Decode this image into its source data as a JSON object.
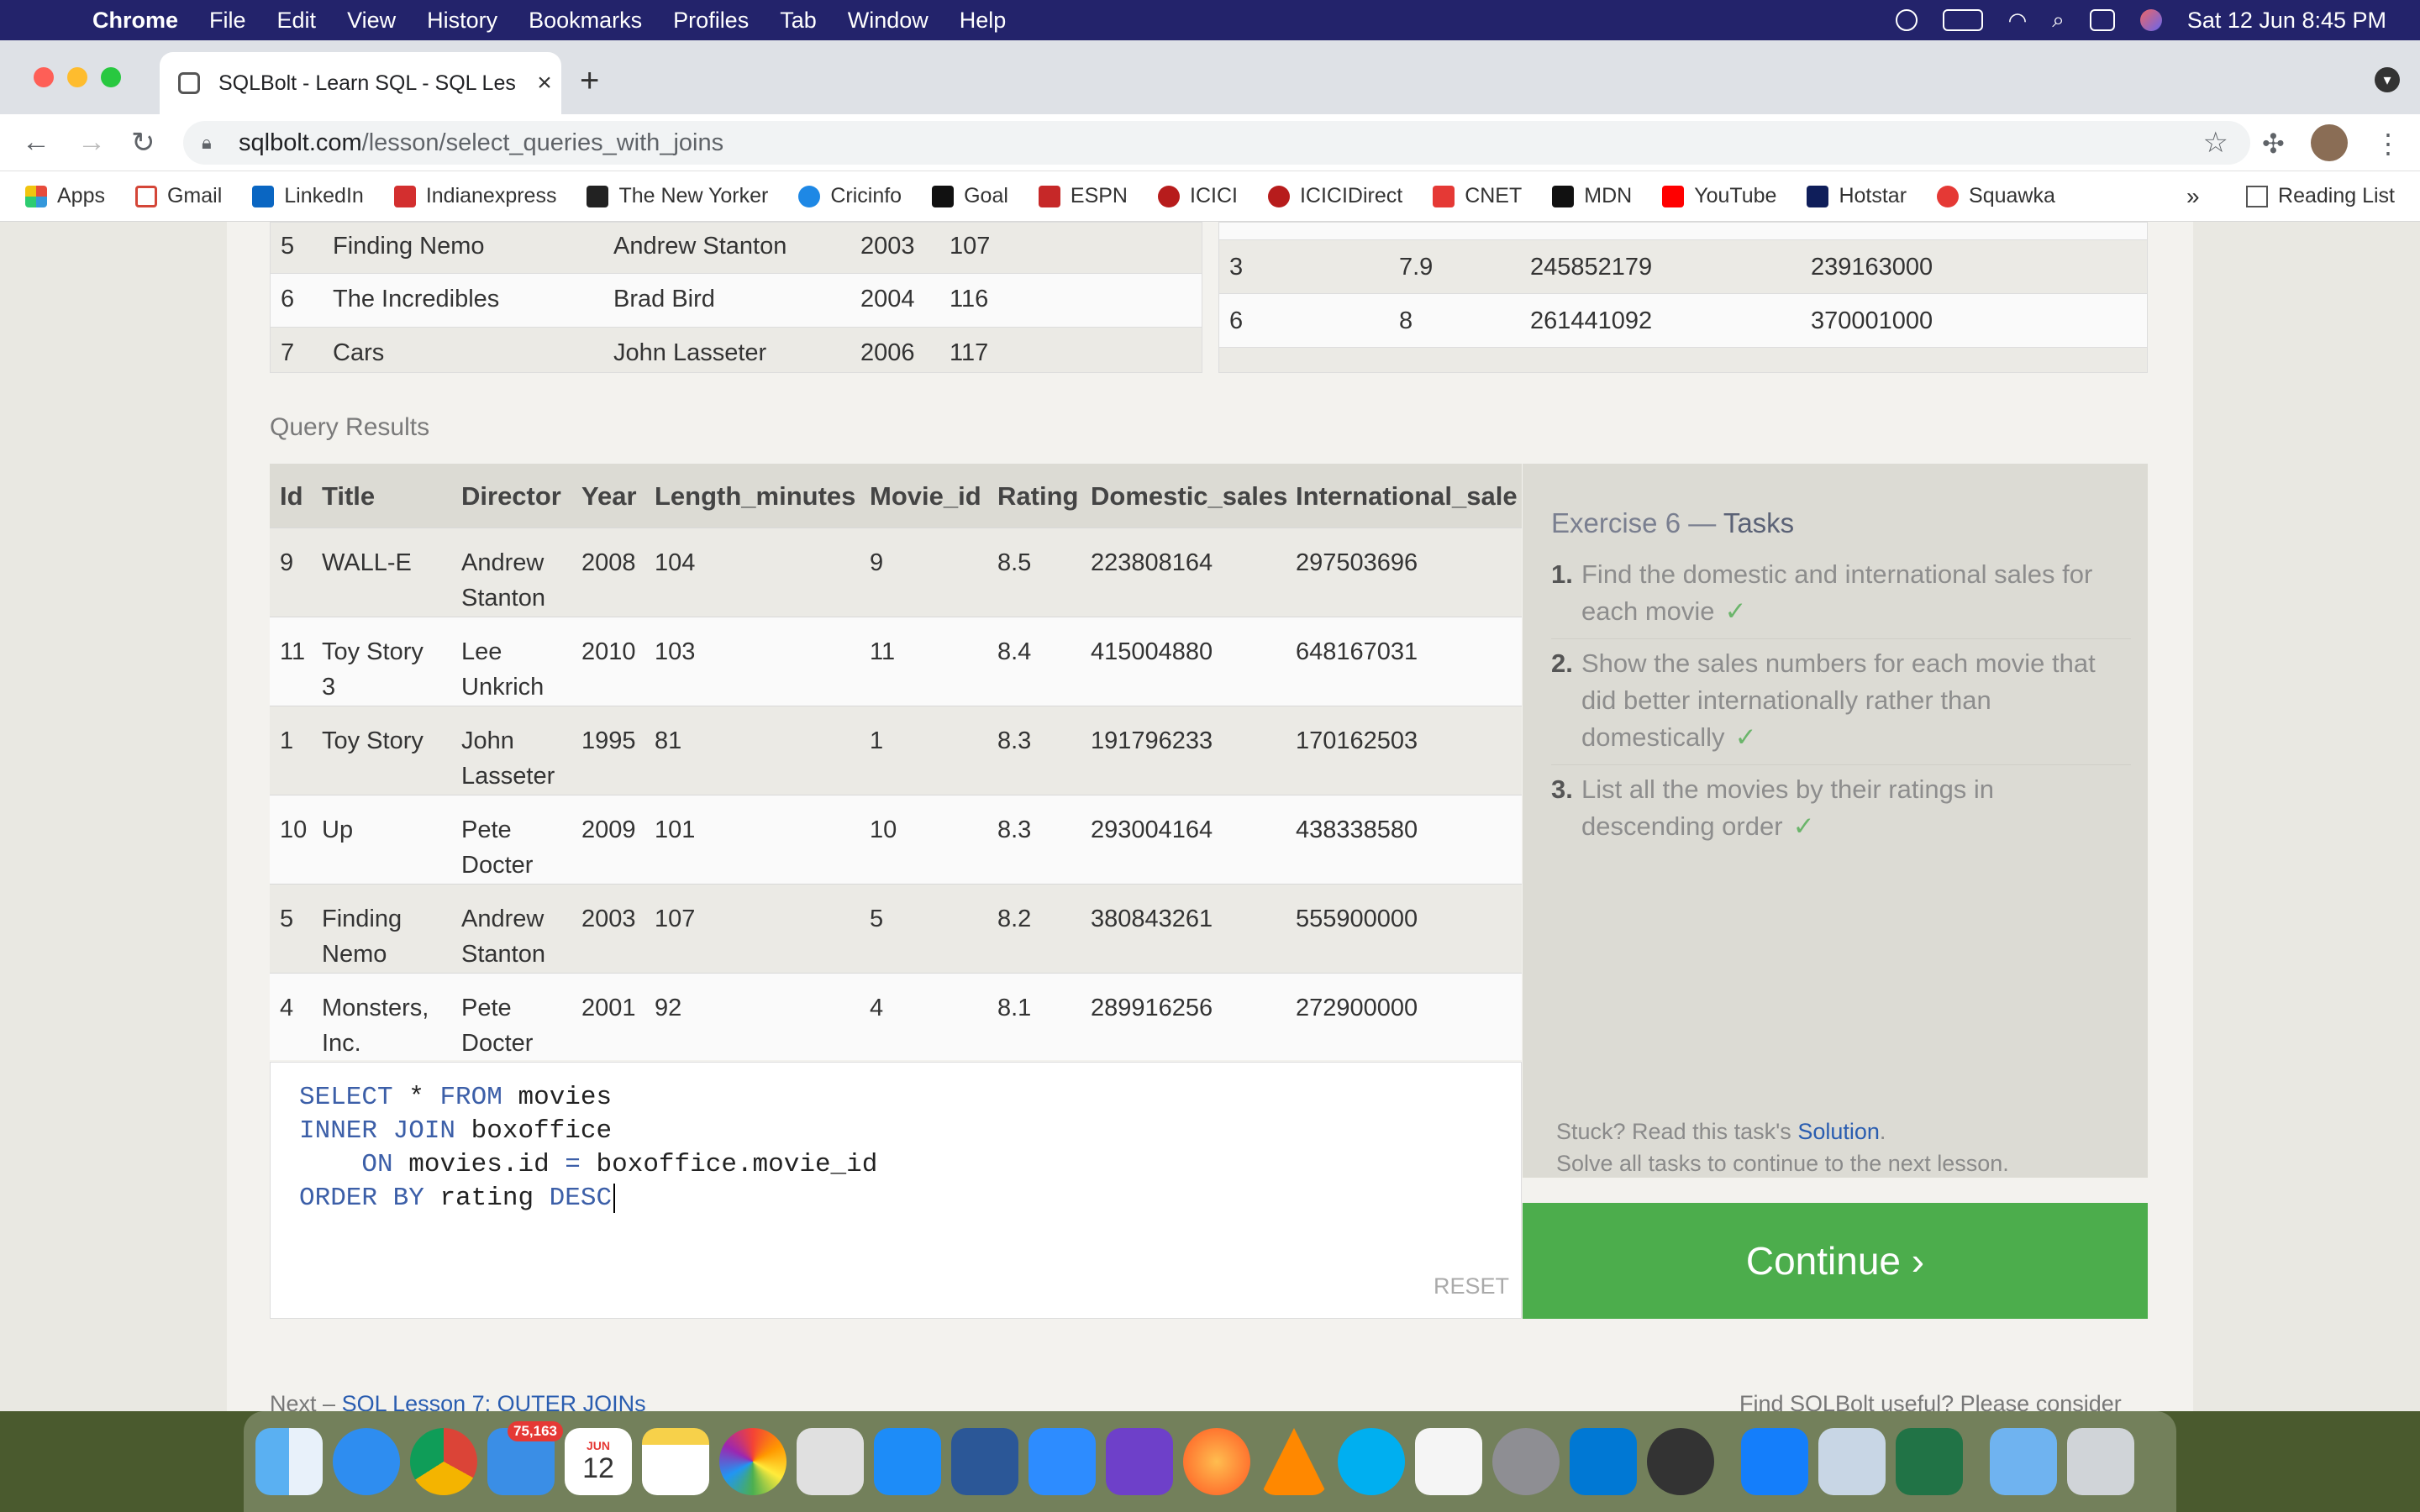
{
  "menubar": {
    "app": "Chrome",
    "items": [
      "File",
      "Edit",
      "View",
      "History",
      "Bookmarks",
      "Profiles",
      "Tab",
      "Window",
      "Help"
    ],
    "clock": "Sat 12 Jun  8:45 PM"
  },
  "tab": {
    "title": "SQLBolt - Learn SQL - SQL Les",
    "close": "×",
    "new_tab": "+"
  },
  "address": {
    "host": "sqlbolt.com",
    "path": "/lesson/select_queries_with_joins"
  },
  "bookmarks": [
    "Apps",
    "Gmail",
    "LinkedIn",
    "Indianexpress",
    "The New Yorker",
    "Cricinfo",
    "Goal",
    "ESPN",
    "ICICI",
    "ICICIDirect",
    "CNET",
    "MDN",
    "YouTube",
    "Hotstar",
    "Squawka"
  ],
  "bookmarks_more": "»",
  "reading_list": "Reading List",
  "movies_table_rows": [
    [
      "5",
      "Finding Nemo",
      "Andrew Stanton",
      "2003",
      "107"
    ],
    [
      "6",
      "The Incredibles",
      "Brad Bird",
      "2004",
      "116"
    ],
    [
      "7",
      "Cars",
      "John Lasseter",
      "2006",
      "117"
    ]
  ],
  "boxoffice_table_rows": [
    [
      "3",
      "7.9",
      "245852179",
      "239163000"
    ],
    [
      "6",
      "8",
      "261441092",
      "370001000"
    ]
  ],
  "query_results_label": "Query Results",
  "results": {
    "headers": [
      "Id",
      "Title",
      "Director",
      "Year",
      "Length_minutes",
      "Movie_id",
      "Rating",
      "Domestic_sales",
      "International_sale"
    ],
    "rows": [
      {
        "id": "9",
        "title1": "WALL-E",
        "title2": "",
        "dir1": "Andrew",
        "dir2": "Stanton",
        "year": "2008",
        "len": "104",
        "mid": "9",
        "rating": "8.5",
        "dom": "223808164",
        "intl": "297503696"
      },
      {
        "id": "11",
        "title1": "Toy Story",
        "title2": "3",
        "dir1": "Lee",
        "dir2": "Unkrich",
        "year": "2010",
        "len": "103",
        "mid": "11",
        "rating": "8.4",
        "dom": "415004880",
        "intl": "648167031"
      },
      {
        "id": "1",
        "title1": "Toy Story",
        "title2": "",
        "dir1": "John",
        "dir2": "Lasseter",
        "year": "1995",
        "len": "81",
        "mid": "1",
        "rating": "8.3",
        "dom": "191796233",
        "intl": "170162503"
      },
      {
        "id": "10",
        "title1": "Up",
        "title2": "",
        "dir1": "Pete",
        "dir2": "Docter",
        "year": "2009",
        "len": "101",
        "mid": "10",
        "rating": "8.3",
        "dom": "293004164",
        "intl": "438338580"
      },
      {
        "id": "5",
        "title1": "Finding",
        "title2": "Nemo",
        "dir1": "Andrew",
        "dir2": "Stanton",
        "year": "2003",
        "len": "107",
        "mid": "5",
        "rating": "8.2",
        "dom": "380843261",
        "intl": "555900000"
      },
      {
        "id": "4",
        "title1": "Monsters,",
        "title2": "Inc.",
        "dir1": "Pete",
        "dir2": "Docter",
        "year": "2001",
        "len": "92",
        "mid": "4",
        "rating": "8.1",
        "dom": "289916256",
        "intl": "272900000"
      }
    ]
  },
  "editor": {
    "line1_kw1": "SELECT",
    "line1_star": "*",
    "line1_kw2": "FROM",
    "line1_rest": "movies",
    "line2_kw": "INNER JOIN",
    "line2_rest": "boxoffice",
    "line3_kw": "ON",
    "line3_a": "movies.id",
    "line3_op": "=",
    "line3_b": "boxoffice.movie_id",
    "line4_kw": "ORDER BY",
    "line4_mid": "rating",
    "line4_kw2": "DESC",
    "reset": "RESET"
  },
  "tasks": {
    "title_prefix": "Exercise 6 —",
    "title_word": "Tasks",
    "items": [
      {
        "n": "1.",
        "text": "Find the domestic and international sales for each movie"
      },
      {
        "n": "2.",
        "text": "Show the sales numbers for each movie that did better internationally rather than domestically"
      },
      {
        "n": "3.",
        "text": "List all the movies by their ratings in descending order"
      }
    ],
    "check": "✓",
    "stuck_prefix": "Stuck? Read this task's",
    "stuck_link": "Solution",
    "stuck_suffix": ".",
    "solve_all": "Solve all tasks to continue to the next lesson.",
    "continue": "Continue ›"
  },
  "footer": {
    "next_prefix": "Next –",
    "next_link": "SQL Lesson 7: OUTER JOINs",
    "useful": "Find SQLBolt useful? Please consider"
  },
  "dock": {
    "mail_badge": "75,163",
    "calendar_month": "JUN",
    "calendar_day": "12"
  }
}
